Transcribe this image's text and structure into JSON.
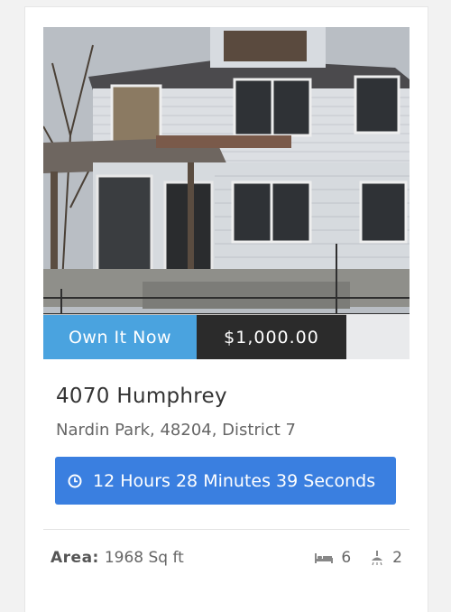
{
  "listing": {
    "cta_label": "Own It Now",
    "price": "$1,000.00",
    "address": "4070 Humphrey",
    "location": "Nardin Park, 48204, District 7",
    "timer": {
      "icon": "clock-icon",
      "hours": "12",
      "hours_label": "Hours",
      "minutes": "28",
      "minutes_label": "Minutes",
      "seconds": "39",
      "seconds_label": "Seconds"
    },
    "area_label": "Area:",
    "area_value": "1968 Sq ft",
    "beds": "6",
    "baths": "2"
  },
  "colors": {
    "cta_blue": "#4aa3df",
    "price_dark": "#2b2b2b",
    "timer_blue": "#3a7fe0"
  }
}
